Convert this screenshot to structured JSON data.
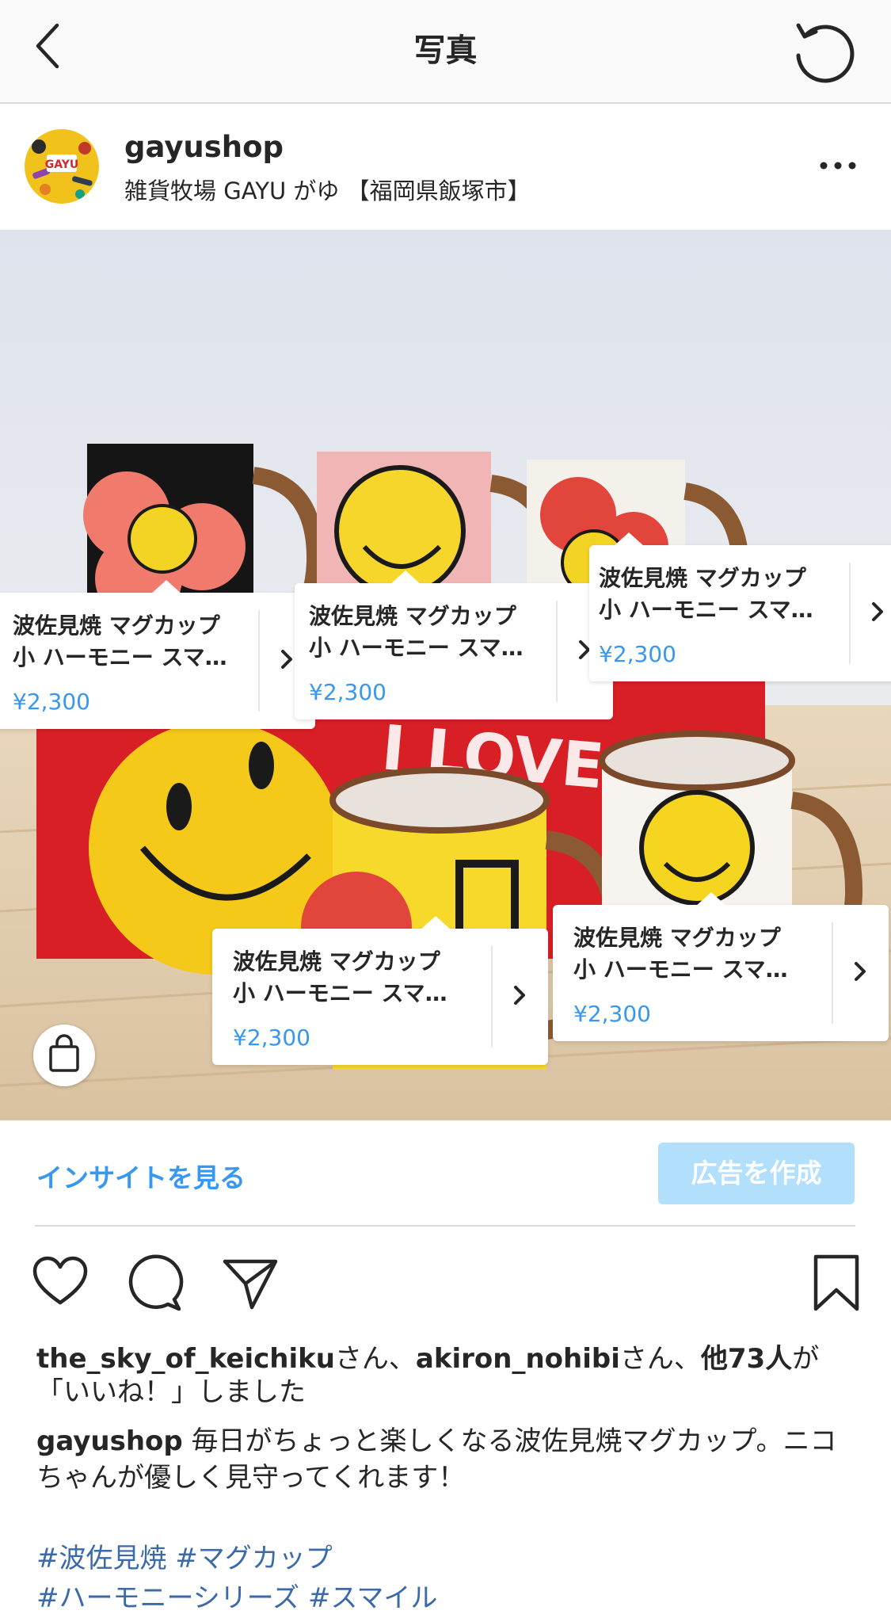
{
  "nav": {
    "title": "写真"
  },
  "post": {
    "username": "gayushop",
    "location": "雑貨牧場 GAYU がゆ 【福岡県飯塚市】",
    "avatar_text": "GAYU"
  },
  "product_tags": [
    {
      "line1": "波佐見焼 マグカップ",
      "line2": "小 ハーモニー スマ…",
      "price": "¥2,300"
    },
    {
      "line1": "波佐見焼 マグカップ",
      "line2": "小 ハーモニー スマ…",
      "price": "¥2,300"
    },
    {
      "line1": "波佐見焼 マグカップ",
      "line2": "小 ハーモニー スマ…",
      "price": "¥2,300"
    },
    {
      "line1": "波佐見焼 マグカップ",
      "line2": "小 ハーモニー スマ…",
      "price": "¥2,300"
    },
    {
      "line1": "波佐見焼 マグカップ",
      "line2": "小 ハーモニー スマ…",
      "price": "¥2,300"
    }
  ],
  "photo_sign_text": "I LOVE",
  "insights": {
    "link_label": "インサイトを見る",
    "create_ad_label": "広告を作成"
  },
  "likes": {
    "user1": "the_sky_of_keichiku",
    "san1": "さん、",
    "user2": "akiron_nohibi",
    "san2": "さん、",
    "others": "他73人",
    "suffix": "が「いいね！」しました"
  },
  "caption": {
    "username": "gayushop",
    "text": " 毎日がちょっと楽しくなる波佐見焼マグカップ。ニコちゃんが優しく見守ってくれます！"
  },
  "hashtags": {
    "line1": "#波佐見焼 #マグカップ",
    "line2": "#ハーモニーシリーズ #スマイル"
  },
  "icons": [
    "back-chevron-icon",
    "refresh-icon",
    "more-dots-icon",
    "shopping-bag-icon",
    "heart-icon",
    "comment-icon",
    "share-icon",
    "bookmark-icon",
    "chevron-right-icon"
  ],
  "colors": {
    "link_blue": "#3897f0",
    "disabled_blue": "#b2dffc",
    "hashtag_blue": "#3a6aa7"
  }
}
